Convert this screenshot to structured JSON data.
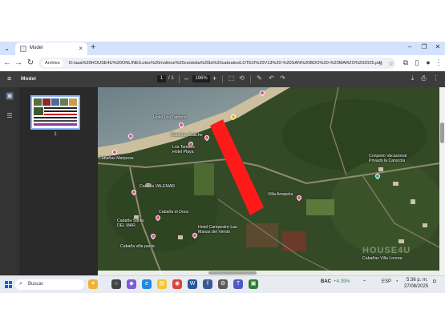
{
  "browser": {
    "tab_title": "Model",
    "tab_close": "×",
    "new_tab": "+",
    "window_controls": [
      "–",
      "❐",
      "✕"
    ],
    "site_chip": "Archivo",
    "url": "D:/aaa%20HOUSE4U%20ONLINE/Lotes%20molinos%20cordoba%20la%20cabrales/LOTEO%20V13%20-%20SAN%20BDO%20-%20MARZO%202025.pdf"
  },
  "pdf_toolbar": {
    "title": "Model",
    "page_current": "1",
    "page_total": "/ 1",
    "zoom_minus": "–",
    "zoom": "196%",
    "zoom_plus": "+"
  },
  "thumbnails": [
    {
      "label": "1"
    }
  ],
  "map": {
    "labels": [
      {
        "text": "Hotel Los Tambos"
      },
      {
        "text": "Cabañas Caliche"
      },
      {
        "text": "Los Tambos\nHotel Playa"
      },
      {
        "text": "Cabañas Mariposa"
      },
      {
        "text": "Villa Amapola"
      },
      {
        "text": "Conjunto Vacacional\nPrivado la Caracola"
      },
      {
        "text": "Cabaña VALEMAR"
      },
      {
        "text": "Cabaña el Doce"
      },
      {
        "text": "Cabaña Santa\nDEL MAR"
      },
      {
        "text": "Hotel Campestre Las\nManas del Viento"
      },
      {
        "text": "Cabaña villa paula"
      },
      {
        "text": "Cabañas Villa Lorena"
      }
    ],
    "watermark": "HOUSE4U"
  },
  "taskbar": {
    "search_placeholder": "Buscar",
    "weather": "BAC",
    "weather_change": "+4.39%",
    "lang": "ESP",
    "time": "5:36 p. m.",
    "date": "27/08/2025"
  }
}
